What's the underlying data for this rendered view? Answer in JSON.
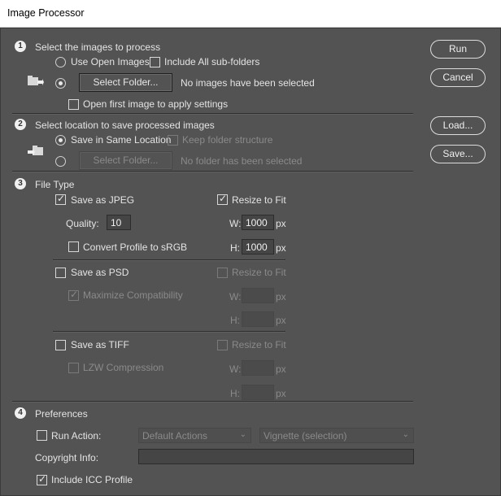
{
  "window": {
    "title": "Image Processor"
  },
  "section1": {
    "number": "1",
    "title": "Select the images to process",
    "use_open_images": "Use Open Images",
    "include_subfolders": "Include All sub-folders",
    "select_folder_button": "Select Folder...",
    "status": "No images have been selected",
    "open_first_image": "Open first image to apply settings"
  },
  "section2": {
    "number": "2",
    "title": "Select location to save processed images",
    "save_same_location": "Save in Same Location",
    "keep_folder_structure": "Keep folder structure",
    "select_folder_button": "Select Folder...",
    "status": "No folder has been selected"
  },
  "section3": {
    "number": "3",
    "title": "File Type",
    "jpeg": {
      "save_as": "Save as JPEG",
      "resize": "Resize to Fit",
      "quality_label": "Quality:",
      "quality_value": "10",
      "w_label": "W:",
      "w_value": "1000",
      "h_label": "H:",
      "h_value": "1000",
      "unit": "px",
      "convert_profile": "Convert Profile to sRGB"
    },
    "psd": {
      "save_as": "Save as PSD",
      "resize": "Resize to Fit",
      "maximize": "Maximize Compatibility",
      "w_label": "W:",
      "h_label": "H:",
      "unit": "px"
    },
    "tiff": {
      "save_as": "Save as TIFF",
      "resize": "Resize to Fit",
      "lzw": "LZW Compression",
      "w_label": "W:",
      "h_label": "H:",
      "unit": "px"
    }
  },
  "section4": {
    "number": "4",
    "title": "Preferences",
    "run_action": "Run Action:",
    "action_set": "Default Actions",
    "action": "Vignette (selection)",
    "copyright_label": "Copyright Info:",
    "copyright_value": "",
    "include_icc": "Include ICC Profile"
  },
  "buttons": {
    "run": "Run",
    "cancel": "Cancel",
    "load": "Load...",
    "save": "Save..."
  },
  "checkmark": "✓"
}
